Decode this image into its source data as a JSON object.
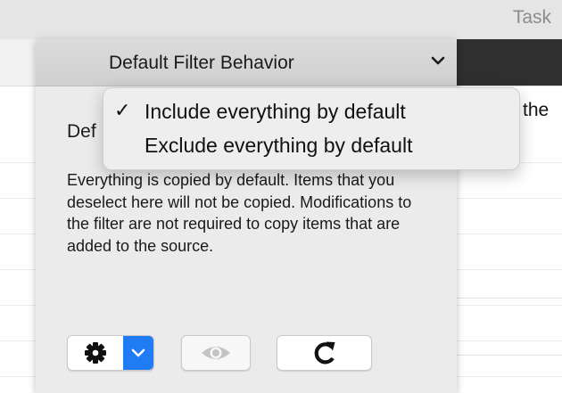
{
  "window": {
    "title": "Task"
  },
  "background": {
    "partial_text": "the"
  },
  "filter_popup": {
    "label": "Default Filter Behavior",
    "chevron_icon": "chevron-down-icon"
  },
  "section": {
    "heading": "Def",
    "description": "Everything is copied by default. Items that you deselect here will not be copied. Modifications to the filter are not required to copy items that are added to the source."
  },
  "menu": {
    "items": [
      {
        "label": "Include everything by default",
        "checked": true
      },
      {
        "label": "Exclude everything by default",
        "checked": false
      }
    ],
    "check_glyph": "✓"
  },
  "toolbar": {
    "gear_icon": "gear-icon",
    "gear_dropdown_icon": "chevron-down-icon",
    "preview_icon": "eye-icon",
    "refresh_icon": "refresh-icon",
    "accent_color": "#1f7cf4"
  }
}
